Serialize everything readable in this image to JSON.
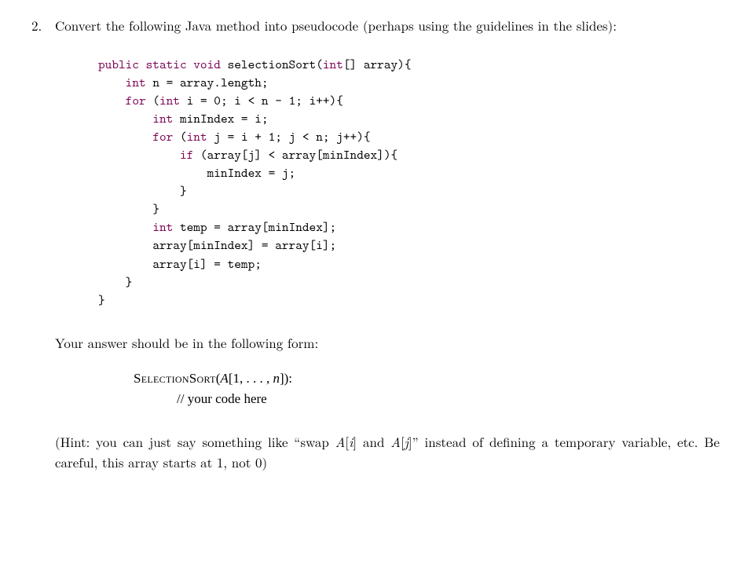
{
  "problem_number": "2.",
  "prompt": "Convert the following Java method into pseudocode (perhaps using the guidelines in the slides):",
  "code": {
    "l1_a": "public static void ",
    "l1_b": "selectionSort(",
    "l1_c": "int",
    "l1_d": "[] array){",
    "l2_a": "int",
    "l2_b": " n = array.length;",
    "l3_a": "for ",
    "l3_b": "(",
    "l3_c": "int",
    "l3_d": " i = 0; i < n - 1; i++){",
    "l4_a": "int",
    "l4_b": " minIndex = i;",
    "l5_a": "for ",
    "l5_b": "(",
    "l5_c": "int",
    "l5_d": " j = i + 1; j < n; j++){",
    "l6_a": "if ",
    "l6_b": "(array[j] < array[minIndex]){",
    "l7": "minIndex = j;",
    "l8": "}",
    "l9": "}",
    "l10_a": "int",
    "l10_b": " temp = array[minIndex];",
    "l11": "array[minIndex] = array[i];",
    "l12": "array[i] = temp;",
    "l13": "}",
    "l14": "}"
  },
  "instruction": "Your answer should be in the following form:",
  "pseudo": {
    "name": "SelectionSort",
    "sig_open": "(",
    "arr": "A",
    "sig_mid": "[1, . . . , ",
    "n": "n",
    "sig_close": "]):",
    "body": "// your code here"
  },
  "hint_open": "(Hint:  you can just say something like “swap ",
  "hint_ai": "A",
  "hint_ai_open": "[",
  "hint_i": "i",
  "hint_ai_close": "]",
  "hint_and": " and ",
  "hint_aj": "A",
  "hint_aj_open": "[",
  "hint_j": "j",
  "hint_aj_close": "]",
  "hint_close": "” instead of defining a temporary variable, etc. Be careful, this array starts at 1, not 0)"
}
